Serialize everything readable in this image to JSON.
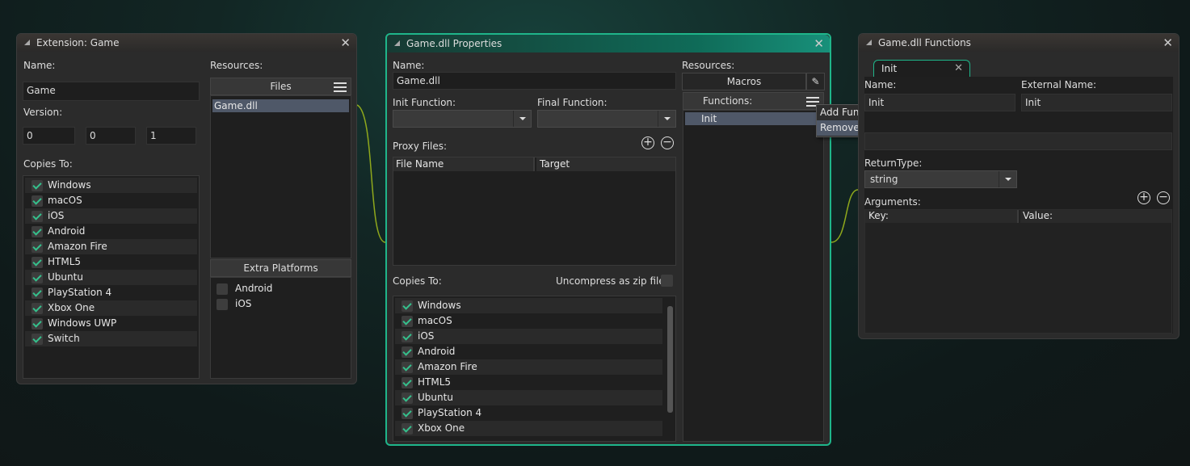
{
  "extension": {
    "title": "Extension: Game",
    "name_label": "Name:",
    "name_value": "Game",
    "version_label": "Version:",
    "version": [
      "0",
      "0",
      "1"
    ],
    "copies_label": "Copies To:",
    "copies": [
      "Windows",
      "macOS",
      "iOS",
      "Android",
      "Amazon Fire",
      "HTML5",
      "Ubuntu",
      "PlayStation 4",
      "Xbox One",
      "Windows UWP",
      "Switch"
    ],
    "resources_label": "Resources:",
    "files_header": "Files",
    "files": [
      "Game.dll"
    ],
    "extra_header": "Extra Platforms",
    "extra": [
      "Android",
      "iOS"
    ]
  },
  "props": {
    "title": "Game.dll Properties",
    "name_label": "Name:",
    "name_value": "Game.dll",
    "init_label": "Init Function:",
    "final_label": "Final Function:",
    "init_value": "",
    "final_value": "",
    "proxy_label": "Proxy Files:",
    "proxy_cols": [
      "File Name",
      "Target"
    ],
    "copies_label": "Copies To:",
    "uncompress_label": "Uncompress as zip file",
    "copies": [
      "Windows",
      "macOS",
      "iOS",
      "Android",
      "Amazon Fire",
      "HTML5",
      "Ubuntu",
      "PlayStation 4",
      "Xbox One"
    ],
    "resources_label": "Resources:",
    "macros_label": "Macros",
    "functions_label": "Functions:",
    "functions": [
      "Init"
    ]
  },
  "context_menu": [
    "Add Function",
    "Remove Selected"
  ],
  "functions": {
    "title": "Game.dll Functions",
    "tab": "Init",
    "name_label": "Name:",
    "name_value": "Init",
    "ext_label": "External Name:",
    "ext_value": "Init",
    "return_label": "ReturnType:",
    "return_value": "string",
    "args_label": "Arguments:",
    "args_cols": [
      "Key:",
      "Value:"
    ]
  },
  "colors": {
    "accent": "#1fb58a",
    "check": "#35c08c"
  }
}
